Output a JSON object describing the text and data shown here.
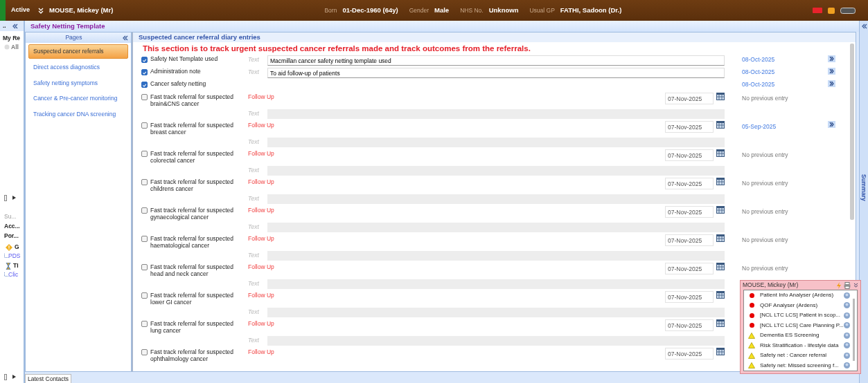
{
  "patient_bar": {
    "status": "Active",
    "name": "MOUSE, Mickey (Mr)",
    "fields": [
      {
        "label": "Born",
        "value": "01-Dec-1960 (64y)"
      },
      {
        "label": "Gender",
        "value": "Male"
      },
      {
        "label": "NHS No.",
        "value": "Unknown"
      },
      {
        "label": "Usual GP",
        "value": "FATHI, Sadoon (Dr.)"
      }
    ]
  },
  "left_panel": {
    "title": "..",
    "heading": "My Re",
    "filter": "All",
    "items": [
      "Su...",
      "Acc...",
      "Por..."
    ],
    "tree": [
      {
        "kind": "warning",
        "label": "G",
        "children": [
          {
            "label": "PDS"
          }
        ]
      },
      {
        "kind": "hourglass",
        "label": "TI",
        "children": [
          {
            "label": "Clic"
          }
        ]
      }
    ]
  },
  "template": {
    "title": "Safety Netting Template"
  },
  "pages": {
    "title": "Pages",
    "items": [
      {
        "label": "Suspected cancer referrals",
        "selected": true
      },
      {
        "label": "Direct access diagnostics",
        "selected": false
      },
      {
        "label": "Safety netting symptoms",
        "selected": false
      },
      {
        "label": "Cancer & Pre-cancer monitoring",
        "selected": false
      },
      {
        "label": "Tracking cancer DNA screening",
        "selected": false
      }
    ]
  },
  "section": {
    "title": "Suspected cancer referral diary entries",
    "notice": "This section is to track urgent suspected cancer referrals made and track outcomes from the referrals."
  },
  "entries": [
    {
      "kind": "note",
      "label": "Safety Net Template used",
      "checked": true,
      "field_label": "Text",
      "value": "Macmillan cancer safety netting template used",
      "previous": "08-Oct-2025",
      "has_history": true
    },
    {
      "kind": "note",
      "label": "Administration note",
      "checked": true,
      "field_label": "Text",
      "value": "To aid follow-up of patients",
      "previous": "08-Oct-2025",
      "has_history": true
    },
    {
      "kind": "note",
      "label": "Cancer safety netting",
      "checked": true,
      "previous": "08-Oct-2025",
      "has_history": true
    },
    {
      "kind": "referral",
      "label": "Fast track referral for suspected brain&CNS cancer",
      "checked": false,
      "action": "Follow Up",
      "date": "07-Nov-2025",
      "previous": "No previous entry",
      "has_history": false,
      "field_label": "Text"
    },
    {
      "kind": "referral",
      "label": "Fast track referral for suspected breast cancer",
      "checked": false,
      "action": "Follow Up",
      "date": "07-Nov-2025",
      "previous": "05-Sep-2025",
      "has_history": true,
      "field_label": "Text"
    },
    {
      "kind": "referral",
      "label": "Fast track referral for suspected colorectal cancer",
      "checked": false,
      "action": "Follow Up",
      "date": "07-Nov-2025",
      "previous": "No previous entry",
      "has_history": false,
      "field_label": "Text"
    },
    {
      "kind": "referral",
      "label": "Fast track referral for suspected childrens cancer",
      "checked": false,
      "action": "Follow Up",
      "date": "07-Nov-2025",
      "previous": "No previous entry",
      "has_history": false,
      "field_label": "Text"
    },
    {
      "kind": "referral",
      "label": "Fast track referral for suspected gynaecological cancer",
      "checked": false,
      "action": "Follow Up",
      "date": "07-Nov-2025",
      "previous": "No previous entry",
      "has_history": false,
      "field_label": "Text"
    },
    {
      "kind": "referral",
      "label": "Fast track referral for suspected haematological cancer",
      "checked": false,
      "action": "Follow Up",
      "date": "07-Nov-2025",
      "previous": "No previous entry",
      "has_history": false,
      "field_label": "Text"
    },
    {
      "kind": "referral",
      "label": "Fast track referral for suspected head and neck cancer",
      "checked": false,
      "action": "Follow Up",
      "date": "07-Nov-2025",
      "previous": "No previous entry",
      "has_history": false,
      "field_label": "Text"
    },
    {
      "kind": "referral",
      "label": "Fast track referral for suspected lower GI cancer",
      "checked": false,
      "action": "Follow Up",
      "date": "07-Nov-2025",
      "field_label": "Text"
    },
    {
      "kind": "referral",
      "label": "Fast track referral for suspected lung cancer",
      "checked": false,
      "action": "Follow Up",
      "date": "07-Nov-2025",
      "field_label": "Text"
    },
    {
      "kind": "referral",
      "label": "Fast track referral for suspected ophthalmology cancer",
      "checked": false,
      "action": "Follow Up",
      "date": "07-Nov-2025"
    }
  ],
  "alerts_popup": {
    "title": "MOUSE, Mickey (Mr)",
    "items": [
      {
        "kind": "alert",
        "label": "Patient Info Analyser (Ardens)"
      },
      {
        "kind": "alert",
        "label": "QOF Analyser (Ardens)"
      },
      {
        "kind": "alert",
        "label": "[NCL LTC LCS] Patient in scop..."
      },
      {
        "kind": "alert",
        "label": "[NCL LTC LCS] Care Planning P..."
      },
      {
        "kind": "warning",
        "label": "Dementia ES Screening"
      },
      {
        "kind": "warning",
        "label": "Risk Stratification - lifestyle data"
      },
      {
        "kind": "warning",
        "label": "Safety net : Cancer referral"
      },
      {
        "kind": "warning",
        "label": "Safety net: Missed screening f..."
      }
    ]
  },
  "bottom_tabs": [
    {
      "label": "Latest Contacts",
      "selected": true
    }
  ],
  "summary_tab": {
    "label": "Summary"
  }
}
